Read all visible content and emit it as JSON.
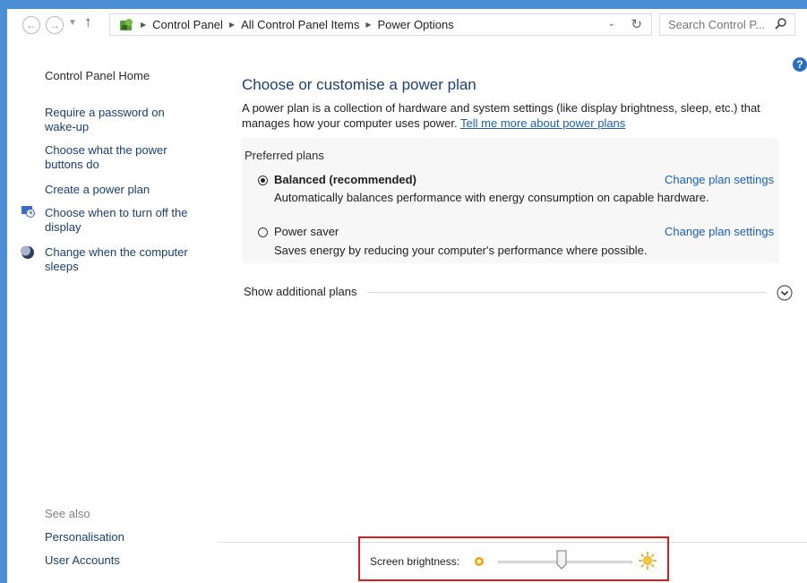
{
  "toolbar": {
    "back_icon": "back-arrow-icon",
    "forward_icon": "forward-arrow-icon",
    "breadcrumb": [
      "Control Panel",
      "All Control Panel Items",
      "Power Options"
    ],
    "search_placeholder": "Search Control P..."
  },
  "sidebar": {
    "home": "Control Panel Home",
    "items": [
      {
        "label_1": "Require a password on",
        "label_2": "wake-up"
      },
      {
        "label_1": "Choose what the power",
        "label_2": "buttons do"
      },
      {
        "label_1": "Create a power plan"
      },
      {
        "label_1": "Choose when to turn off the",
        "label_2": "display",
        "icon": "display-clock-icon"
      },
      {
        "label_1": "Change when the computer",
        "label_2": "sleeps",
        "icon": "moon-icon"
      }
    ],
    "see_also": "See also",
    "see_also_links": [
      "Personalisation",
      "User Accounts"
    ]
  },
  "main": {
    "title": "Choose or customise a power plan",
    "description": "A power plan is a collection of hardware and system settings (like display brightness, sleep, etc.) that manages how your computer uses power.",
    "tell_more_link": "Tell me more about power plans",
    "preferred_title": "Preferred plans",
    "plans": [
      {
        "name": "Balanced (recommended)",
        "description": "Automatically balances performance with energy consumption on capable hardware.",
        "selected": true,
        "link": "Change plan settings"
      },
      {
        "name": "Power saver",
        "description": "Saves energy by reducing your computer's performance where possible.",
        "selected": false,
        "link": "Change plan settings"
      }
    ],
    "show_additional": "Show additional plans"
  },
  "brightness": {
    "label": "Screen brightness:",
    "level_fraction": 0.47
  },
  "colors": {
    "accent": "#4a8ed6",
    "link": "#1a5fb4",
    "title": "#1e3f71",
    "highlight_border": "#d81e1e"
  }
}
